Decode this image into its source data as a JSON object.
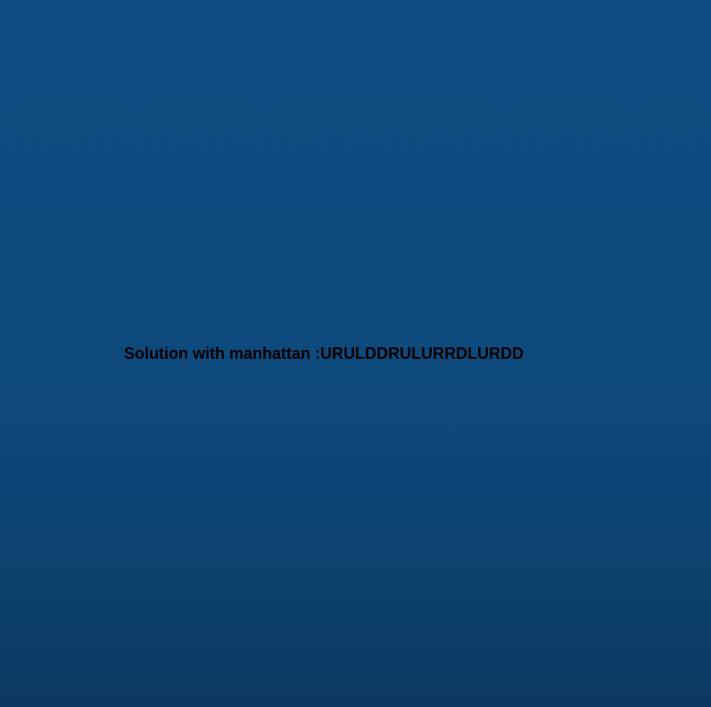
{
  "result": {
    "prefix": "Solution with manhattan :",
    "path": "URULDDRULURRDLURDD"
  },
  "colors": {
    "background_top": "#0f4b80",
    "background_bottom": "#0b3960",
    "text": "#000000"
  }
}
